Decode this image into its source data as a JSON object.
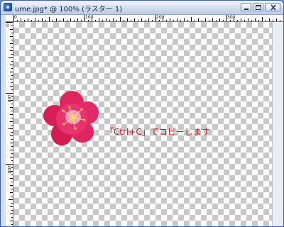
{
  "window": {
    "title": "ume.jpg* @ 100% (ラスター 1)",
    "icon": "paint-app-icon",
    "buttons": {
      "minimize": "minimize-icon",
      "maximize": "maximize-icon",
      "close": "close-icon"
    }
  },
  "rulers": {
    "top_labels": [
      "0",
      "100",
      "200",
      "300"
    ],
    "left_labels": [
      "0",
      "100",
      "200"
    ]
  },
  "canvas": {
    "background": "transparency-checkerboard",
    "image": "plum-blossom",
    "instruction_text": "「Ctrl+C」でコピーします"
  },
  "colors": {
    "titlebar_text": "#0d1f44",
    "instruction": "#c4141c",
    "flower": "#e0245e",
    "flower_center": "#f7c35b"
  }
}
